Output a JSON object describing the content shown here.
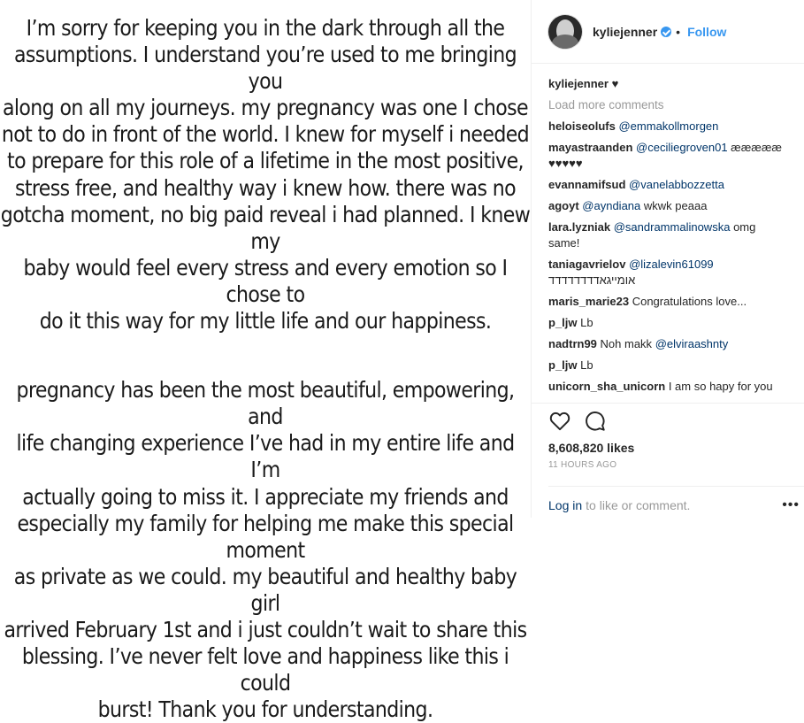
{
  "post": {
    "paragraph1": "I’m sorry for keeping you in the dark through all the\nassumptions. I understand you’re used to me bringing you\nalong on all my journeys. my pregnancy was one I chose\nnot to do in front of the world. I knew for myself i needed\nto prepare for this role of a lifetime in the most positive,\nstress free, and healthy way i knew how. there was no\ngotcha moment, no big paid reveal i had planned. I knew my\nbaby would feel every stress and every emotion so I chose to\ndo it this way for my little life and our happiness.",
    "paragraph2": "pregnancy has been the most beautiful, empowering, and\nlife changing experience I’ve had in my entire life and I’m\nactually going to miss it. I appreciate my friends and\nespecially my family for helping me make this special moment\nas private as we could. my beautiful and healthy baby girl\narrived February 1st and i just couldn’t wait to share this\nblessing. I’ve never felt love and happiness like this i could\nburst! Thank you for understanding."
  },
  "header": {
    "username": "kyliejenner",
    "separator": "•",
    "follow_label": "Follow"
  },
  "caption": {
    "user": "kyliejenner",
    "text": "♥"
  },
  "load_more": "Load more comments",
  "comments": [
    {
      "user": "heloiseolufs",
      "mention": "@emmakollmorgen",
      "text": ""
    },
    {
      "user": "mayastraanden",
      "mention": "@ceciliegroven01",
      "text": "æææææ ♥♥♥♥♥"
    },
    {
      "user": "evannamifsud",
      "mention": "@vanelabbozzetta",
      "text": ""
    },
    {
      "user": "agoyt",
      "mention": "@ayndiana",
      "text": "wkwk peaaa"
    },
    {
      "user": "lara.lyzniak",
      "mention": "@sandrammalinowska",
      "text": "omg same!"
    },
    {
      "user": "taniagavrielov",
      "mention": "@lizalevin61099",
      "text": "אומייגאדדדדדדדד"
    },
    {
      "user": "maris_marie23",
      "mention": "",
      "text": "Congratulations love..."
    },
    {
      "user": "p_ljw",
      "mention": "",
      "text": "Lb"
    },
    {
      "user": "nadtrn99",
      "mention": "@elviraashnty",
      "text": "Noh makk"
    },
    {
      "user": "p_ljw",
      "mention": "",
      "text": "Lb"
    },
    {
      "user": "unicorn_sha_unicorn",
      "mention": "",
      "text": "I am so hapy for you"
    }
  ],
  "likes": "8,608,820 likes",
  "timestamp": "11 HOURS AGO",
  "login": {
    "link": "Log in",
    "text": "to like or comment."
  },
  "icons": {
    "verified": "verified-badge-icon",
    "heart": "heart-icon",
    "comment": "comment-icon",
    "more": "more-options-icon"
  },
  "colors": {
    "link": "#3897f0",
    "mention": "#003569",
    "muted": "#999999"
  }
}
